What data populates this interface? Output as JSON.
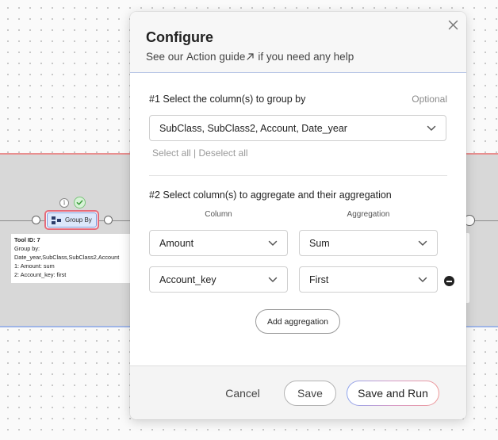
{
  "canvas": {
    "node": {
      "label": "Group By",
      "icon": "group-by-icon"
    },
    "status": {
      "info_symbol": "i",
      "ok_icon": "check-icon"
    },
    "tooltip": {
      "lines": [
        "Tool ID: 7",
        "Group by:",
        "Date_year,SubClass,SubClass2,Account",
        "1: Amount: sum",
        "2: Account_key: first"
      ]
    }
  },
  "modal": {
    "title": "Configure",
    "subtitle_prefix": "See our ",
    "guide_link": "Action guide",
    "subtitle_suffix": "if you need any help",
    "close_icon": "close-icon",
    "section1": {
      "title": "#1 Select the column(s) to group by",
      "optional": "Optional",
      "selected": "SubClass, SubClass2, Account, Date_year",
      "select_all": "Select all",
      "separator": " | ",
      "deselect_all": "Deselect all"
    },
    "section2": {
      "title": "#2 Select column(s) to aggregate and their aggregation",
      "column_header": "Column",
      "aggregation_header": "Aggregation",
      "rows": [
        {
          "column": "Amount",
          "aggregation": "Sum"
        },
        {
          "column": "Account_key",
          "aggregation": "First"
        }
      ],
      "add_label": "Add aggregation"
    },
    "footer": {
      "cancel": "Cancel",
      "save": "Save",
      "save_run": "Save and Run"
    }
  },
  "colors": {
    "node_border": "#e46b7b",
    "node_fill": "#dce7fb",
    "band_top": "#e98f8f",
    "band_bottom": "#9fb5e6"
  }
}
